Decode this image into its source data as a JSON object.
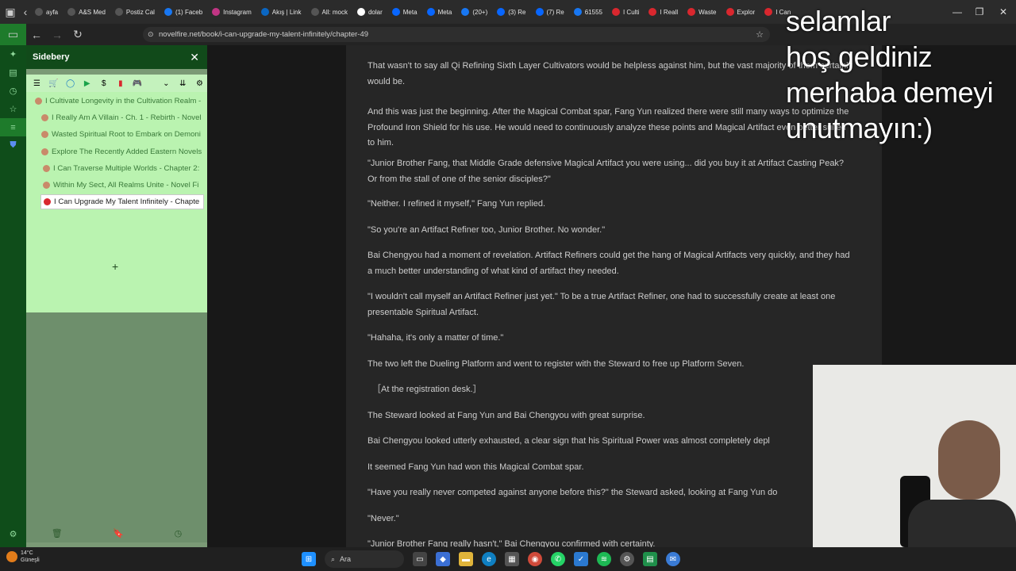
{
  "browser": {
    "tabs": [
      {
        "label": "ayfa",
        "icon": "page-icon",
        "color": "#555"
      },
      {
        "label": "A&S Med",
        "icon": "page-icon",
        "color": "#555"
      },
      {
        "label": "Postiz Cal",
        "icon": "page-icon",
        "color": "#555"
      },
      {
        "label": "(1) Faceb",
        "icon": "facebook-icon",
        "color": "#1877f2"
      },
      {
        "label": "Instagram",
        "icon": "instagram-icon",
        "color": "#c13584"
      },
      {
        "label": "Akış | Link",
        "icon": "linkedin-icon",
        "color": "#0a66c2"
      },
      {
        "label": "All: mock",
        "icon": "page-icon",
        "color": "#555"
      },
      {
        "label": "dolar",
        "icon": "google-icon",
        "color": "#fff"
      },
      {
        "label": "Meta",
        "icon": "meta-icon",
        "color": "#0866ff"
      },
      {
        "label": "Meta",
        "icon": "meta-icon",
        "color": "#0866ff"
      },
      {
        "label": "(20+)",
        "icon": "facebook-icon",
        "color": "#1877f2"
      },
      {
        "label": "(3) Re",
        "icon": "meta-icon",
        "color": "#0866ff"
      },
      {
        "label": "(7) Re",
        "icon": "meta-icon",
        "color": "#0866ff"
      },
      {
        "label": "61555",
        "icon": "facebook-icon",
        "color": "#1877f2"
      },
      {
        "label": "I Culti",
        "icon": "novelfire-icon",
        "color": "#d9272e"
      },
      {
        "label": "I Reall",
        "icon": "novelfire-icon",
        "color": "#d9272e"
      },
      {
        "label": "Waste",
        "icon": "novelfire-icon",
        "color": "#d9272e"
      },
      {
        "label": "Explor",
        "icon": "novelfire-icon",
        "color": "#d9272e"
      },
      {
        "label": "I Can",
        "icon": "novelfire-icon",
        "color": "#d9272e"
      }
    ],
    "url": "novelfire.net/book/i-can-upgrade-my-talent-infinitely/chapter-49"
  },
  "sidebar": {
    "title": "Sidebery",
    "tabs": [
      {
        "label": "I Cultivate Longevity in the Cultivation Realm -",
        "indent": 0
      },
      {
        "label": "I Really Am A Villain - Ch. 1 - Rebirth - Novel",
        "indent": 1
      },
      {
        "label": "Wasted Spiritual Root to Embark on Demoni",
        "indent": 1
      },
      {
        "label": "Explore The Recently Added Eastern Novels -",
        "indent": 1
      },
      {
        "label": "I Can Traverse Multiple Worlds - Chapter 2:",
        "indent": 2
      },
      {
        "label": "Within My Sect, All Realms Unite - Novel Fi",
        "indent": 2
      },
      {
        "label": "I Can Upgrade My Talent Infinitely - Chapte",
        "indent": 2,
        "active": true
      }
    ],
    "new_tab": "+"
  },
  "article": {
    "paragraphs": [
      "That wasn't to say all Qi Refining Sixth Layer Cultivators would be helpless against him, but the vast majority of them certainly would be.",
      "And this was just the beginning. After the Magical Combat spar, Fang Yun realized there were still many ways to optimize the Profound Iron Shield for his use. He would need to continuously analyze these points and Magical Artifact even better suited to him.",
      "\"Junior Brother Fang, that Middle Grade defensive Magical Artifact you were using... did you buy it at Artifact Casting Peak? Or from the stall of one of the senior disciples?\"",
      "\"Neither. I refined it myself,\" Fang Yun replied.",
      "\"So you're an Artifact Refiner too, Junior Brother. No wonder.\"",
      "Bai Chengyou had a moment of revelation. Artifact Refiners could get the hang of Magical Artifacts very quickly, and they had a much better understanding of what kind of artifact they needed.",
      "\"I wouldn't call myself an Artifact Refiner just yet.\" To be a true Artifact Refiner, one had to successfully create at least one presentable Spiritual Artifact.",
      "\"Hahaha, it's only a matter of time.\"",
      "The two left the Dueling Platform and went to register with the Steward to free up Platform Seven.",
      "［At the registration desk.］",
      "The Steward looked at Fang Yun and Bai Chengyou with great surprise.",
      "Bai Chengyou looked utterly exhausted, a clear sign that his Spiritual Power was almost completely depl",
      "It seemed Fang Yun had won this Magical Combat spar.",
      "\"Have you really never competed against anyone before this?\" the Steward asked, looking at Fang Yun do",
      "\"Never.\"",
      "\"Junior Brother Fang really hasn't,\" Bai Chengyou confirmed with certainty."
    ]
  },
  "overlay": {
    "lines": [
      "selamlar",
      "hoş geldiniz",
      "merhaba demeyi",
      "unutmayın:)"
    ]
  },
  "taskbar": {
    "temperature": "14°C",
    "weather": "Güneşli",
    "search_placeholder": "Ara"
  }
}
